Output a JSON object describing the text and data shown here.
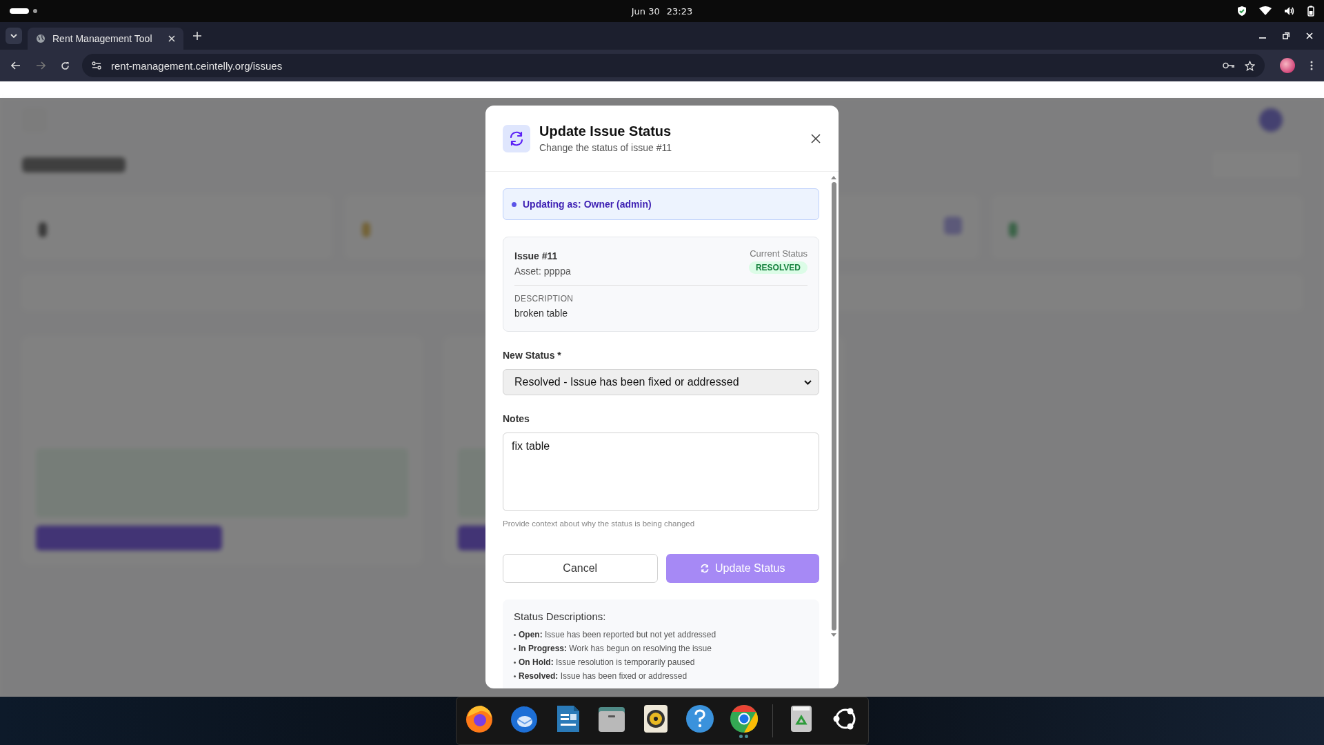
{
  "system_bar": {
    "date": "Jun 30",
    "time": "23:23"
  },
  "browser": {
    "tab_title": "Rent Management Tool",
    "url": "rent-management.ceintelly.org/issues"
  },
  "modal": {
    "title": "Update Issue Status",
    "subtitle": "Change the status of issue #11",
    "role_banner": "Updating as: Owner (admin)",
    "issue": {
      "label": "Issue #11",
      "asset": "Asset: ppppa",
      "current_status_label": "Current Status",
      "status_badge": "RESOLVED",
      "description_label": "DESCRIPTION",
      "description": "broken table"
    },
    "new_status": {
      "label": "New Status *",
      "value": "Resolved - Issue has been fixed or addressed"
    },
    "notes": {
      "label": "Notes",
      "value": "fix table",
      "helper": "Provide context about why the status is being changed"
    },
    "buttons": [
      {
        "kind": "cancel",
        "label": "Cancel"
      },
      {
        "kind": "submit",
        "label": "Update Status"
      }
    ],
    "status_descriptions": {
      "title": "Status Descriptions:",
      "items": [
        "**Open:** Issue has been reported but not yet addressed",
        "**In Progress:** Work has begun on resolving the issue",
        "**On Hold:** Issue resolution is temporarily paused",
        "**Resolved:** Issue has been fixed or addressed"
      ]
    }
  },
  "dock": [
    {
      "kind": "firefox",
      "running": false
    },
    {
      "kind": "thunderbird",
      "running": false
    },
    {
      "kind": "writer",
      "running": false
    },
    {
      "kind": "files",
      "running": false
    },
    {
      "kind": "rhythmbox",
      "running": false
    },
    {
      "kind": "help",
      "running": false
    },
    {
      "kind": "chrome",
      "running": true
    },
    {
      "kind": "trash",
      "running": false
    },
    {
      "kind": "apps",
      "running": false
    }
  ]
}
